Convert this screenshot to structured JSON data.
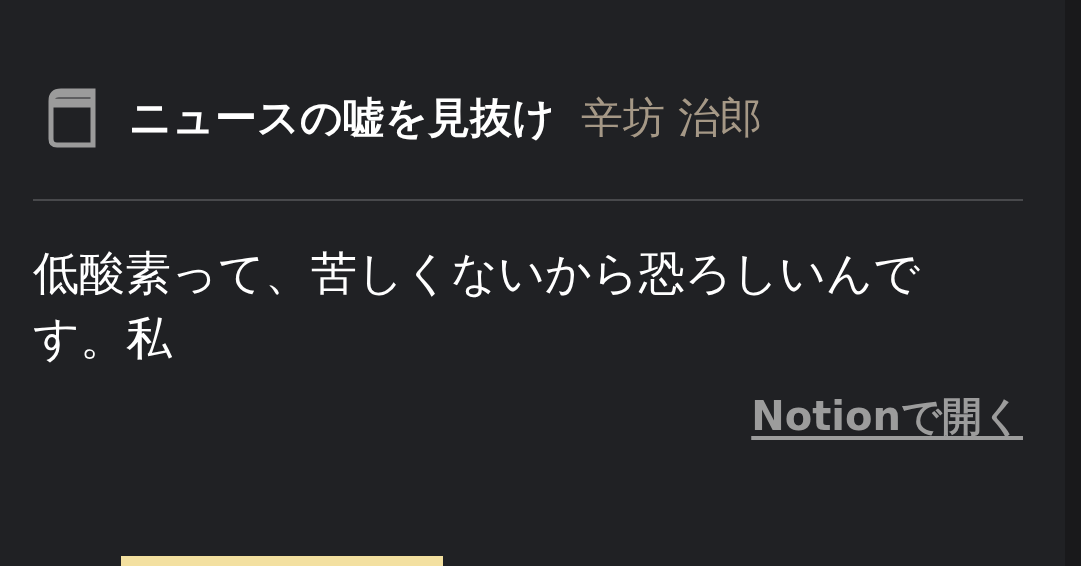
{
  "card": {
    "title": "ニュースの嘘を見抜け",
    "author": "辛坊 治郎",
    "excerpt": "低酸素って、苦しくないから恐ろしいんです。私",
    "link": "Notionで開く"
  }
}
